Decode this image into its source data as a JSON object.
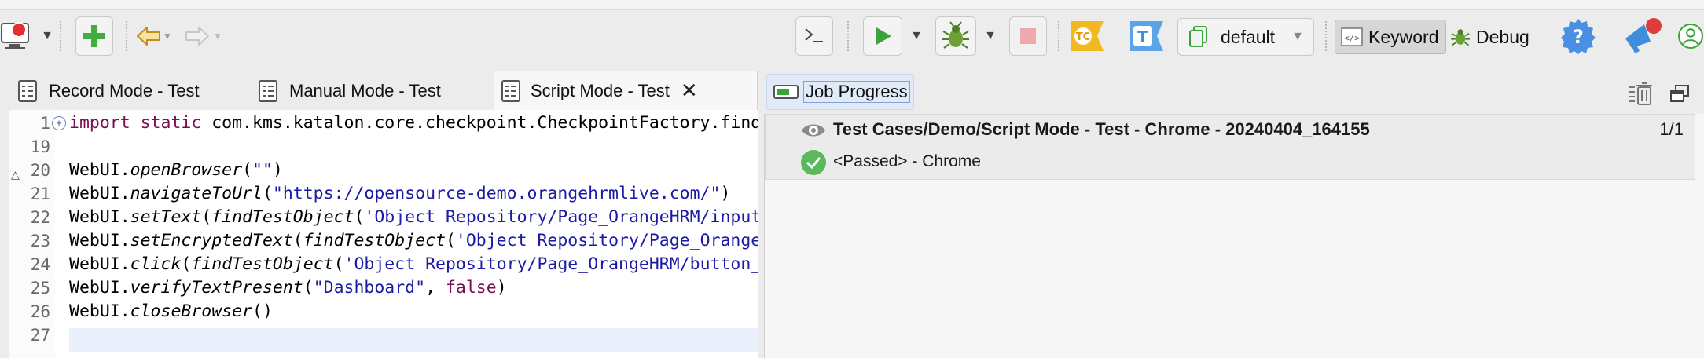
{
  "toolbar": {
    "profile_value": "default",
    "keyword_label": "Keyword",
    "debug_label": "Debug"
  },
  "editor_tabs": [
    {
      "label": "Record Mode - Test"
    },
    {
      "label": "Manual Mode - Test"
    },
    {
      "label": "Script Mode - Test"
    }
  ],
  "code": [
    {
      "ln": "1",
      "parts": [
        {
          "t": "import static",
          "c": "kw"
        },
        {
          "t": " com.kms.katalon.core.checkpoint.CheckpointFactory.findCheckpoint"
        }
      ]
    },
    {
      "ln": "19",
      "parts": []
    },
    {
      "ln": "20",
      "parts": [
        {
          "t": "WebUI."
        },
        {
          "t": "openBrowser",
          "c": "it"
        },
        {
          "t": "("
        },
        {
          "t": "\"\"",
          "c": "str"
        },
        {
          "t": ")"
        }
      ]
    },
    {
      "ln": "21",
      "parts": [
        {
          "t": "WebUI."
        },
        {
          "t": "navigateToUrl",
          "c": "it"
        },
        {
          "t": "("
        },
        {
          "t": "\"https://opensource-demo.orangehrmlive.com/\"",
          "c": "str"
        },
        {
          "t": ")"
        }
      ]
    },
    {
      "ln": "22",
      "parts": [
        {
          "t": "WebUI."
        },
        {
          "t": "setText",
          "c": "it"
        },
        {
          "t": "("
        },
        {
          "t": "findTestObject",
          "c": "it"
        },
        {
          "t": "("
        },
        {
          "t": "'Object Repository/Page_OrangeHRM/input_Username'",
          "c": "str"
        }
      ]
    },
    {
      "ln": "23",
      "parts": [
        {
          "t": "WebUI."
        },
        {
          "t": "setEncryptedText",
          "c": "it"
        },
        {
          "t": "("
        },
        {
          "t": "findTestObject",
          "c": "it"
        },
        {
          "t": "("
        },
        {
          "t": "'Object Repository/Page_OrangeHRM/input_Password'",
          "c": "str"
        }
      ]
    },
    {
      "ln": "24",
      "parts": [
        {
          "t": "WebUI."
        },
        {
          "t": "click",
          "c": "it"
        },
        {
          "t": "("
        },
        {
          "t": "findTestObject",
          "c": "it"
        },
        {
          "t": "("
        },
        {
          "t": "'Object Repository/Page_OrangeHRM/button_Login'",
          "c": "str"
        }
      ]
    },
    {
      "ln": "25",
      "parts": [
        {
          "t": "WebUI."
        },
        {
          "t": "verifyTextPresent",
          "c": "it"
        },
        {
          "t": "("
        },
        {
          "t": "\"Dashboard\"",
          "c": "str"
        },
        {
          "t": ", "
        },
        {
          "t": "false",
          "c": "kw"
        },
        {
          "t": ")"
        }
      ]
    },
    {
      "ln": "26",
      "parts": [
        {
          "t": "WebUI."
        },
        {
          "t": "closeBrowser",
          "c": "it"
        },
        {
          "t": "()"
        }
      ]
    },
    {
      "ln": "27",
      "parts": []
    }
  ],
  "job_progress": {
    "tab_label": "Job Progress",
    "job_name": "Test Cases/Demo/Script Mode - Test - Chrome - 20240404_164155",
    "count": "1/1",
    "status": "<Passed> - Chrome"
  },
  "colors": {
    "keyword": "#7a0d54",
    "string": "#1a1aa6",
    "passed": "#5cb85c",
    "add_green": "#3fae3f",
    "run_green": "#3aa33a"
  }
}
